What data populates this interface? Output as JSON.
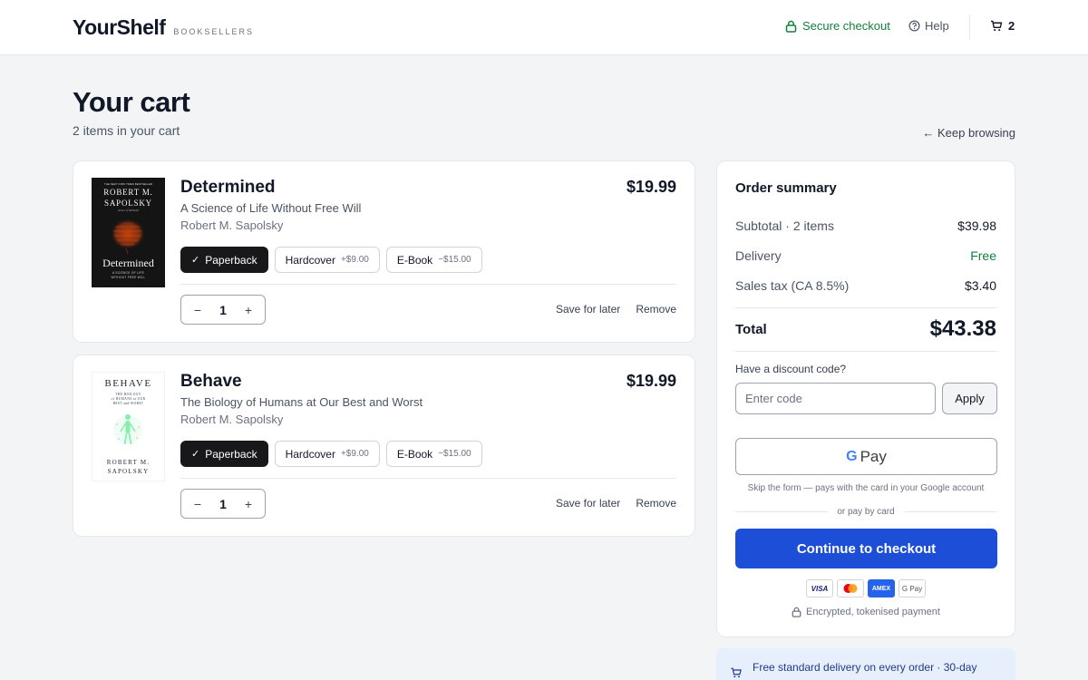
{
  "header": {
    "brand": "YourShelf",
    "brand_sub": "BOOKSELLERS",
    "secure_checkout": "Secure checkout",
    "help": "Help",
    "cart_count": "2"
  },
  "page": {
    "title": "Your cart",
    "subtitle": "2 items in your cart",
    "keep_browsing": "← Keep browsing"
  },
  "items": [
    {
      "title": "Determined",
      "subtitle": "A Science of Life Without Free Will",
      "author": "Robert M. Sapolsky",
      "price": "$19.99",
      "cover": {
        "top_line": "THE NEW YORK TIMES BESTSELLER",
        "author_line1": "ROBERT M.",
        "author_line2": "SAPOLSKY",
        "byline": "Author of BEHAVE",
        "title": "Determined",
        "tagline1": "A SCIENCE OF LIFE",
        "tagline2": "WITHOUT FREE WILL"
      },
      "formats": [
        {
          "label": "Paperback",
          "modifier": ""
        },
        {
          "label": "Hardcover",
          "modifier": "+$9.00"
        },
        {
          "label": "E-Book",
          "modifier": "−$15.00"
        }
      ],
      "quantity": "1",
      "save_label": "Save for later",
      "remove_label": "Remove"
    },
    {
      "title": "Behave",
      "subtitle": "The Biology of Humans at Our Best and Worst",
      "author": "Robert M. Sapolsky",
      "price": "$19.99",
      "cover": {
        "title": "BEHAVE",
        "tagline1": "THE BIOLOGY",
        "tagline2": "of HUMANS at OUR",
        "tagline3": "BEST and WORST",
        "author_line1": "ROBERT M.",
        "author_line2": "SAPOLSKY"
      },
      "formats": [
        {
          "label": "Paperback",
          "modifier": ""
        },
        {
          "label": "Hardcover",
          "modifier": "+$9.00"
        },
        {
          "label": "E-Book",
          "modifier": "−$15.00"
        }
      ],
      "quantity": "1",
      "save_label": "Save for later",
      "remove_label": "Remove"
    }
  ],
  "quantity_controls": {
    "decrement": "−",
    "increment": "+"
  },
  "format_check": "✓",
  "summary": {
    "title": "Order summary",
    "subtotal_label": "Subtotal · 2 items",
    "subtotal_value": "$39.98",
    "delivery_label": "Delivery",
    "delivery_value": "Free",
    "tax_label": "Sales tax (CA 8.5%)",
    "tax_value": "$3.40",
    "total_label": "Total",
    "total_value": "$43.38",
    "discount_label": "Have a discount code?",
    "discount_placeholder": "Enter code",
    "apply_label": "Apply",
    "gpay_g": "G",
    "gpay_label": "Pay",
    "gpay_note": "Skip the form — pays with the card in your Google account",
    "or_label": "or pay by card",
    "checkout_label": "Continue to checkout",
    "cards": [
      "VISA",
      "",
      "AMEX",
      "G Pay"
    ],
    "secure_note": "Encrypted, tokenised payment"
  },
  "delivery_banner": {
    "text": "Free standard delivery on every order · 30-day"
  },
  "colors": {
    "accent": "#1d4ed8",
    "success": "#15803d",
    "selected_format": "#18181b",
    "background": "#f3f4f6"
  },
  "icons": [
    "lock-icon",
    "help-circle-icon",
    "cart-icon",
    "check-icon",
    "truck-icon"
  ]
}
